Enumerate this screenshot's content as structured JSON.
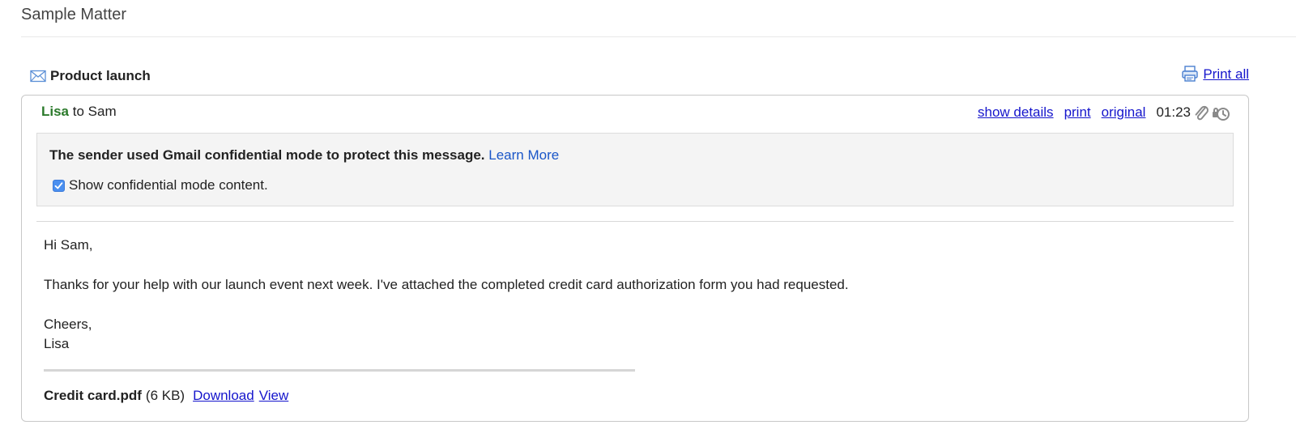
{
  "matter": {
    "title": "Sample Matter"
  },
  "thread": {
    "subject": "Product launch",
    "print_all_label": "Print all",
    "mail_icon": "envelope-icon",
    "printer_icon": "printer-icon"
  },
  "message": {
    "sender": "Lisa",
    "recipient_text": "to Sam",
    "actions": {
      "show_details": "show details",
      "print": "print",
      "original": "original"
    },
    "time": "01:23",
    "icons": [
      "paperclip-icon",
      "confidential-clock-icon"
    ],
    "notice": {
      "text": "The sender used Gmail confidential mode to protect this message.",
      "link": "Learn More",
      "checkbox_label": "Show confidential mode content.",
      "checkbox_checked": true
    },
    "body": {
      "greeting": "Hi Sam,",
      "paragraph": "Thanks for your help with our launch event next week. I've attached the completed credit card authorization form you had requested.",
      "signoff": "Cheers,",
      "signature": "Lisa"
    },
    "attachment": {
      "name": "Credit card.pdf",
      "size": "(6 KB)",
      "download_label": "Download",
      "view_label": "View"
    }
  },
  "colors": {
    "sender": "#2b7a2b",
    "link": "#1515cc",
    "notice_link": "#1a56c8",
    "notice_bg": "#f4f4f4",
    "checkbox": "#4a8ff0"
  }
}
